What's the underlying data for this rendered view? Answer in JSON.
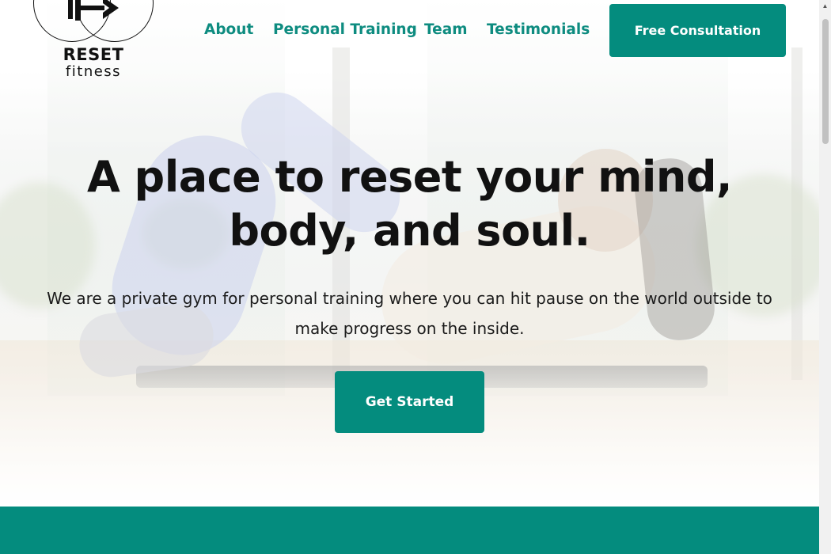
{
  "brand": {
    "name": "RESET",
    "tagline": "fitness"
  },
  "nav": {
    "items": [
      {
        "label": "About"
      },
      {
        "label": "Personal Training"
      },
      {
        "label": "Team"
      },
      {
        "label": "Testimonials"
      }
    ],
    "cta_label": "Free Consultation"
  },
  "hero": {
    "title": "A place to reset your mind, body, and soul.",
    "text": "We are a private gym for personal training where you can hit pause on the world outside to make progress on the inside.",
    "button_label": "Get Started"
  },
  "colors": {
    "accent": "#048c7e",
    "nav_link": "#0e8c80",
    "text": "#111111"
  },
  "icons": {
    "logo": "dumbbell-icon",
    "scroll_up": "scroll-up-arrow-icon"
  }
}
